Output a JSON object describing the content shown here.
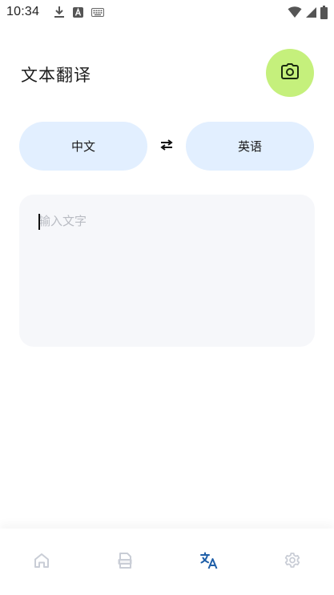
{
  "status_bar": {
    "time": "10:34",
    "icons_left": [
      "download-icon",
      "a-square-icon",
      "keyboard-icon"
    ],
    "icons_right": [
      "wifi-icon",
      "signal-icon",
      "battery-icon"
    ]
  },
  "header": {
    "title": "文本翻译",
    "camera_icon": "camera-icon",
    "accent_color": "#c5f07c"
  },
  "languages": {
    "source": "中文",
    "target": "英语",
    "swap_icon": "swap-arrows-icon",
    "pill_color": "#e2efff"
  },
  "input": {
    "value": "",
    "placeholder": "输入文字"
  },
  "bottom_nav": {
    "items": [
      {
        "icon": "home-icon",
        "active": false
      },
      {
        "icon": "document-icon",
        "active": false
      },
      {
        "icon": "translate-icon",
        "active": true
      },
      {
        "icon": "settings-icon",
        "active": false
      }
    ],
    "active_color": "#1f5fa8",
    "inactive_color": "#c9cdd6"
  }
}
